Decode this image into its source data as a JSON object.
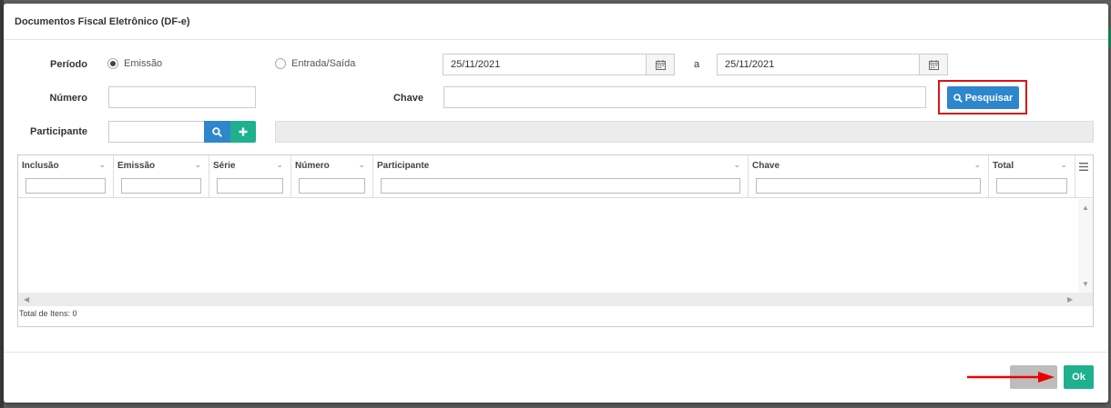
{
  "modal": {
    "title": "Documentos Fiscal Eletrônico (DF-e)"
  },
  "form": {
    "periodo_label": "Período",
    "radio_emissao": "Emissão",
    "radio_entrada_saida": "Entrada/Saída",
    "date_from": "25/11/2021",
    "date_sep": "a",
    "date_to": "25/11/2021",
    "numero_label": "Número",
    "numero_value": "",
    "chave_label": "Chave",
    "chave_value": "",
    "participante_label": "Participante",
    "participante_value": "",
    "search_button": "Pesquisar"
  },
  "grid": {
    "columns": [
      "Inclusão",
      "Emissão",
      "Série",
      "Número",
      "Participante",
      "Chave",
      "Total"
    ],
    "footer": "Total de Itens: 0"
  },
  "footer": {
    "ok_button": "Ok"
  },
  "colors": {
    "primary_blue": "#2e86cc",
    "accent_green": "#1fb08e",
    "highlight_red": "#d6161a"
  }
}
